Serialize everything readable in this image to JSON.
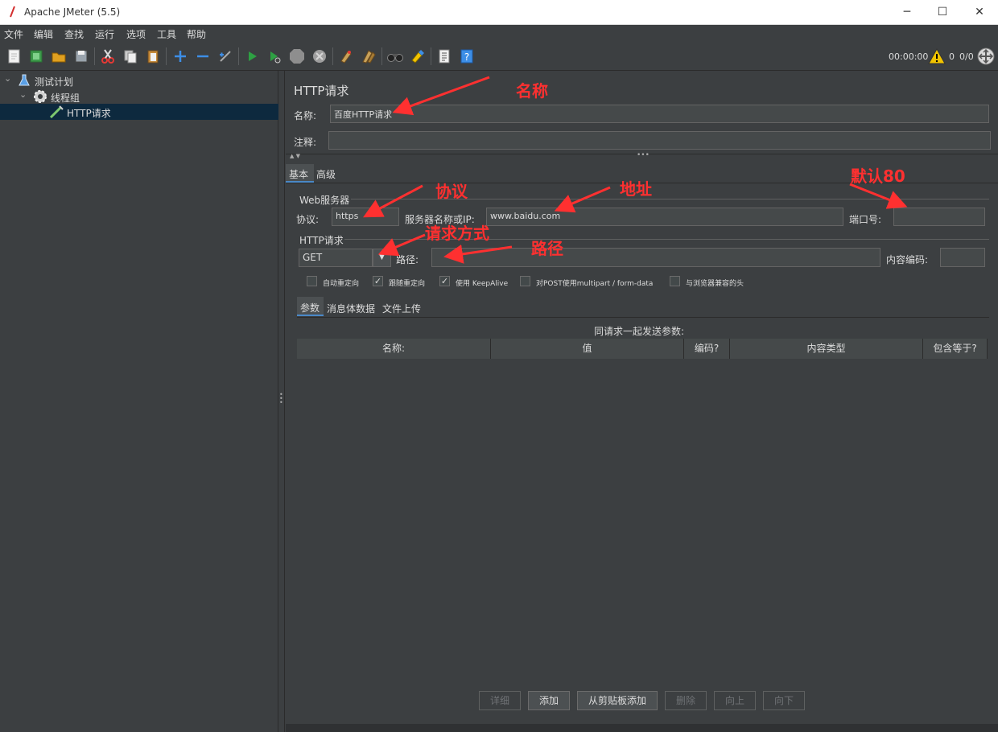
{
  "window": {
    "title": "Apache JMeter (5.5)",
    "minimize": "─",
    "maximize": "☐",
    "close": "✕"
  },
  "menu": [
    "文件",
    "编辑",
    "查找",
    "运行",
    "选项",
    "工具",
    "帮助"
  ],
  "toolbar": {
    "timer": "00:00:00",
    "warn_count": "0",
    "threads": "0/0"
  },
  "tree": {
    "plan": "测试计划",
    "group": "线程组",
    "request": "HTTP请求"
  },
  "panel": {
    "title": "HTTP请求",
    "name_label": "名称:",
    "name_value": "百度HTTP请求",
    "comment_label": "注释:",
    "comment_value": "",
    "tabs": [
      "基本",
      "高级"
    ],
    "web_server": {
      "section": "Web服务器",
      "protocol_label": "协议:",
      "protocol_value": "https",
      "server_label": "服务器名称或IP:",
      "server_value": "www.baidu.com",
      "port_label": "端口号:",
      "port_value": ""
    },
    "http_request": {
      "section": "HTTP请求",
      "method": "GET",
      "path_label": "路径:",
      "path_value": "",
      "encoding_label": "内容编码:",
      "encoding_value": ""
    },
    "checkboxes": [
      {
        "label": "自动重定向",
        "checked": false
      },
      {
        "label": "跟随重定向",
        "checked": true
      },
      {
        "label": "使用 KeepAlive",
        "checked": true
      },
      {
        "label": "对POST使用multipart / form-data",
        "checked": false
      },
      {
        "label": "与浏览器兼容的头",
        "checked": false
      }
    ],
    "subtabs": [
      "参数",
      "消息体数据",
      "文件上传"
    ],
    "params_caption": "同请求一起发送参数:",
    "columns": [
      "名称:",
      "值",
      "编码?",
      "内容类型",
      "包含等于?"
    ],
    "buttons": {
      "detail": "详细",
      "add": "添加",
      "add_clipboard": "从剪贴板添加",
      "delete": "删除",
      "up": "向上",
      "down": "向下"
    }
  },
  "annotations": {
    "name": "名称",
    "protocol": "协议",
    "address": "地址",
    "port_default": "默认80",
    "method": "请求方式",
    "path": "路径"
  },
  "colors": {
    "bg": "#3c3f41",
    "field": "#45494a",
    "selection": "#0d293e",
    "annotation": "#ff3030"
  }
}
